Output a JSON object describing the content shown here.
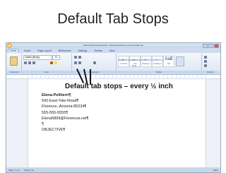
{
  "slide": {
    "title": "Default Tab Stops"
  },
  "window": {
    "title": "Word (Technical Account) - Microsoft Word non-commercial use"
  },
  "ribbon": {
    "tabs": [
      "Home",
      "Insert",
      "Page Layout",
      "References",
      "Mailings",
      "Review",
      "View"
    ],
    "groups": [
      "Clipboard",
      "Font",
      "Paragraph",
      "Styles",
      "Editing"
    ],
    "font_name": "Calibri (Body)",
    "font_size": "11",
    "styles": [
      {
        "sample": "AaBbCcDc",
        "name": "1 Normal"
      },
      {
        "sample": "AaBbCcDc",
        "name": "1 No Spaci..."
      },
      {
        "sample": "AaBbCc",
        "name": "Heading 1"
      },
      {
        "sample": "AaBbCc",
        "name": "Heading 2"
      },
      {
        "sample": "AaB",
        "name": "Title"
      }
    ]
  },
  "annotation": {
    "text": "Default tab stops – every ½ inch"
  },
  "document": {
    "lines": [
      "Elena-Pelliterri¶",
      "542-East-Yale-Road¶",
      "Florence,-Arizona-85234¶",
      "555-555-5555¶",
      "Elena5899@Florencia.net¶",
      "¶",
      "OBJECTIVE¶"
    ]
  },
  "status": {
    "page": "Page: 1 of 1",
    "words": "Words: 94",
    "zoom": "100%"
  }
}
